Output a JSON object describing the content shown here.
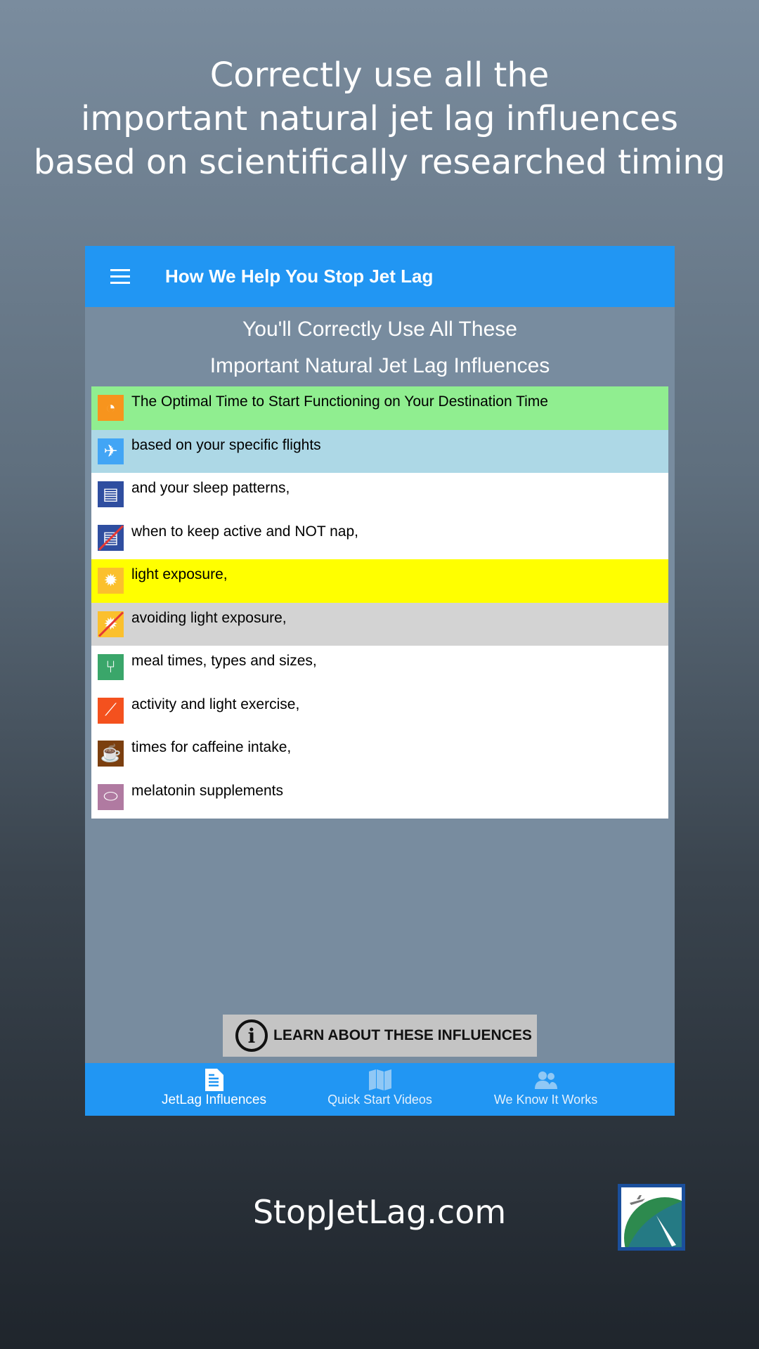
{
  "headline": [
    "Correctly use all the",
    "important natural jet lag influences",
    "based on scientifically researched timing"
  ],
  "app": {
    "title": "How We Help You Stop Jet Lag",
    "subtitle": [
      "You'll Correctly Use All These",
      "Important Natural Jet Lag Influences"
    ],
    "items": [
      {
        "label": "The Optimal Time to Start Functioning on Your Destination Time",
        "icon": "clock-icon",
        "bg": "#90ee90",
        "icon_color": "#f7941d"
      },
      {
        "label": "based on your specific flights",
        "icon": "airplane-icon",
        "bg": "#add8e6",
        "icon_color": "#42a5f5"
      },
      {
        "label": "and your sleep patterns,",
        "icon": "bed-icon",
        "bg": "#ffffff",
        "icon_color": "#2f4ea0"
      },
      {
        "label": "when to keep active and NOT nap,",
        "icon": "no-bed-icon",
        "bg": "#ffffff",
        "icon_color": "#2f4ea0"
      },
      {
        "label": "light exposure,",
        "icon": "sun-icon",
        "bg": "#ffff00",
        "icon_color": "#fbc02d"
      },
      {
        "label": "avoiding light exposure,",
        "icon": "no-sun-icon",
        "bg": "#d3d3d3",
        "icon_color": "#fbc02d"
      },
      {
        "label": "meal times, types and sizes,",
        "icon": "meal-icon",
        "bg": "#ffffff",
        "icon_color": "#3aa66a"
      },
      {
        "label": "activity and light exercise,",
        "icon": "exercise-icon",
        "bg": "#ffffff",
        "icon_color": "#f4511e"
      },
      {
        "label": "times for caffeine intake,",
        "icon": "coffee-icon",
        "bg": "#ffffff",
        "icon_color": "#7b3f0f"
      },
      {
        "label": "melatonin supplements",
        "icon": "pill-icon",
        "bg": "#ffffff",
        "icon_color": "#b07aa1"
      }
    ],
    "learn_button": "LEARN ABOUT THESE INFLUENCES",
    "nav": [
      {
        "label": "JetLag Influences",
        "icon": "document-icon",
        "active": true
      },
      {
        "label": "Quick Start Videos",
        "icon": "map-icon",
        "active": false
      },
      {
        "label": "We Know It Works",
        "icon": "people-icon",
        "active": false
      }
    ]
  },
  "site": "StopJetLag.com",
  "colors": {
    "accent": "#2196f3",
    "panel": "#788c9f"
  }
}
